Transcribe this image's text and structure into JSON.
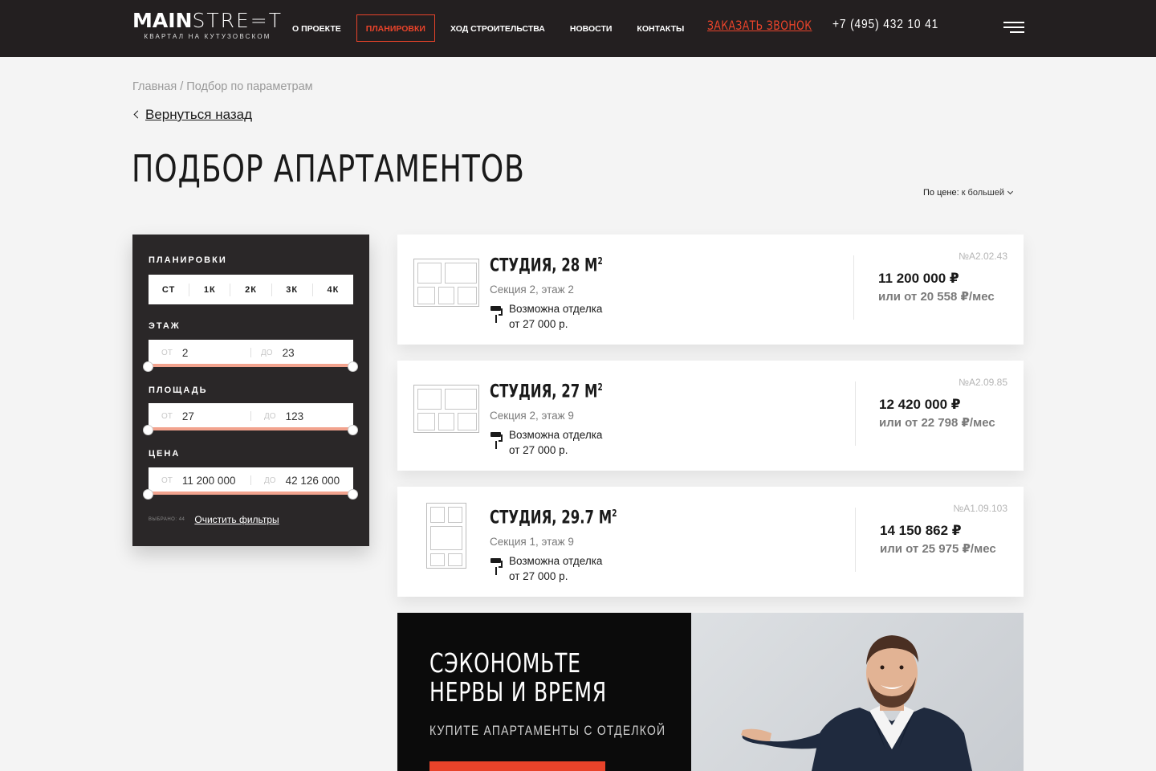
{
  "header": {
    "logo_main_bold": "MAIN",
    "logo_main_light": "STRE=T",
    "logo_sub": "КВАРТАЛ НА КУТУЗОВСКОМ",
    "nav": [
      {
        "label": "О ПРОЕКТЕ",
        "active": false
      },
      {
        "label": "ПЛАНИРОВКИ",
        "active": true
      },
      {
        "label": "ХОД СТРОИТЕЛЬСТВА",
        "active": false
      },
      {
        "label": "НОВОСТИ",
        "active": false
      },
      {
        "label": "КОНТАКТЫ",
        "active": false
      }
    ],
    "callback": "ЗАКАЗАТЬ ЗВОНОК",
    "phone": "+7 (495) 432 10 41",
    "menu_icon": "burger-menu-icon"
  },
  "breadcrumb": "Главная / Подбор по параметрам",
  "back_label": "Вернуться назад",
  "page_title": "ПОДБОР АПАРТАМЕНТОВ",
  "sort": {
    "label": "По цене:",
    "value": "к большей"
  },
  "filter": {
    "types_label": "ПЛАНИРОВКИ",
    "types": [
      "СТ",
      "1К",
      "2К",
      "3К",
      "4К"
    ],
    "floor": {
      "label": "ЭТАЖ",
      "from_prefix": "ОТ",
      "from": "2",
      "to_prefix": "ДО",
      "to": "23"
    },
    "area": {
      "label": "ПЛОЩАДЬ",
      "from_prefix": "ОТ",
      "from": "27",
      "to_prefix": "ДО",
      "to": "123"
    },
    "price": {
      "label": "ЦЕНА",
      "from_prefix": "ОТ",
      "from": "11 200 000",
      "to_prefix": "ДО",
      "to": "42 126 000"
    },
    "selected": "ВЫБРАНО: 44",
    "clear": "Очистить фильтры"
  },
  "cards": [
    {
      "title": "СТУДИЯ, 28 М",
      "sup": "2",
      "sub": "Секция 2, этаж 2",
      "finish1": "Возможна отделка",
      "finish2": "от 27 000 р.",
      "code": "№А2.02.43",
      "price": "11 200 000 ₽",
      "mortgage": "или от 20 558 ₽/мес"
    },
    {
      "title": "СТУДИЯ, 27 М",
      "sup": "2",
      "sub": "Секция 2, этаж 9",
      "finish1": "Возможна отделка",
      "finish2": "от 27 000 р.",
      "code": "№А2.09.85",
      "price": "12 420 000 ₽",
      "mortgage": "или от 22 798 ₽/мес"
    },
    {
      "title": "СТУДИЯ, 29.7 М",
      "sup": "2",
      "sub": "Секция 1, этаж 9",
      "finish1": "Возможна отделка",
      "finish2": "от 27 000 р.",
      "code": "№А1.09.103",
      "price": "14 150 862 ₽",
      "mortgage": "или от 25 975 ₽/мес"
    }
  ],
  "promo": {
    "title_line1": "СЭКОНОМЬТЕ",
    "title_line2": "НЕРВЫ И ВРЕМЯ",
    "subtitle": "КУПИТЕ АПАРТАМЕНТЫ С ОТДЕЛКОЙ"
  },
  "colors": {
    "accent": "#e8432a",
    "dark": "#231f20",
    "panel": "#2a2728",
    "track": "#f2a38e"
  }
}
